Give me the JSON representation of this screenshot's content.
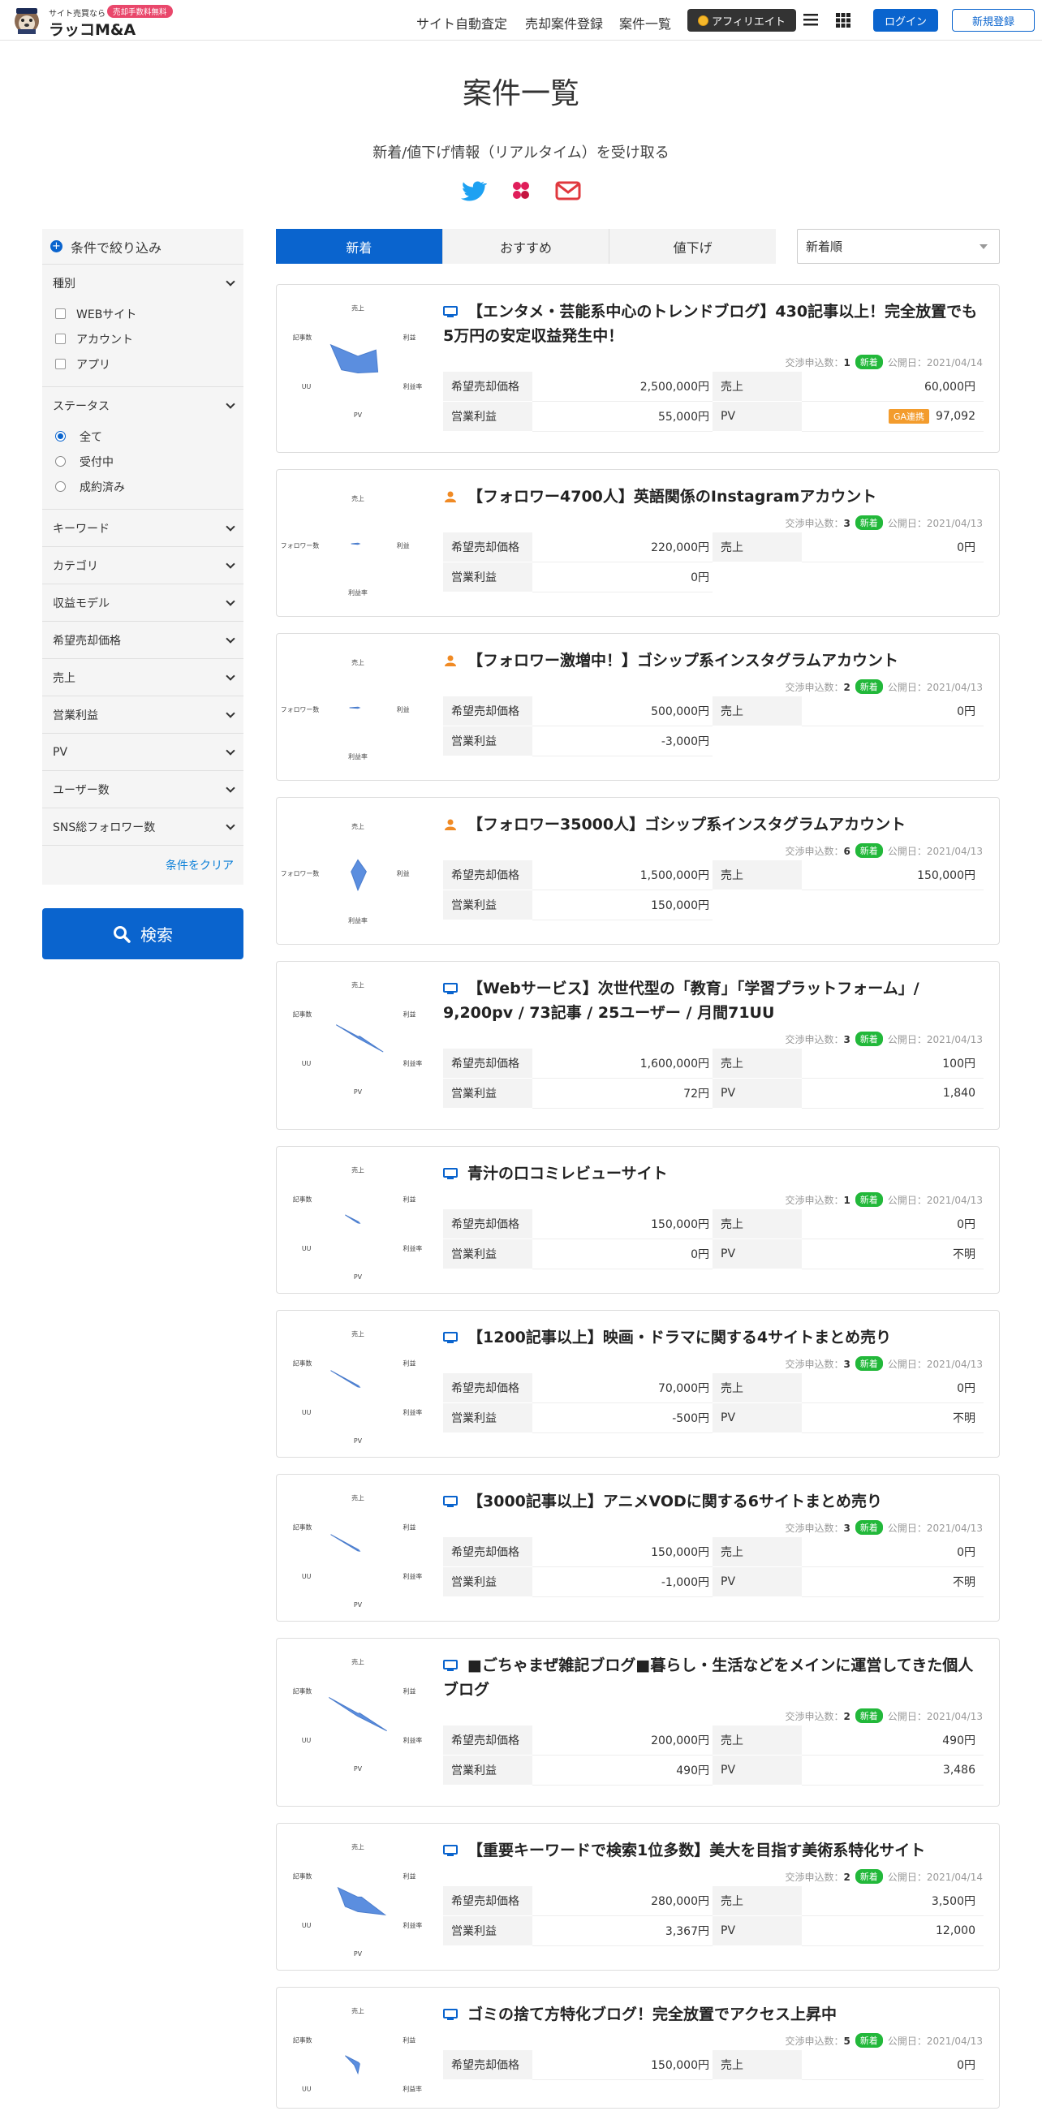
{
  "header": {
    "logo_small": "サイト売買なら",
    "logo_badge": "売却手数料無料",
    "logo_name": "ラッコM&A",
    "nav": [
      "サイト自動査定",
      "売却案件登録",
      "案件一覧"
    ],
    "affiliate": "アフィリエイト",
    "login": "ログイン",
    "register": "新規登録"
  },
  "page": {
    "title": "案件一覧",
    "subscribe": "新着/値下げ情報（リアルタイム）を受け取る"
  },
  "sidebar": {
    "heading": "条件で絞り込み",
    "type_title": "種別",
    "type_options": [
      "WEBサイト",
      "アカウント",
      "アプリ"
    ],
    "status_title": "ステータス",
    "status_options": [
      "全て",
      "受付中",
      "成約済み"
    ],
    "filters": [
      "キーワード",
      "カテゴリ",
      "収益モデル",
      "希望売却価格",
      "売上",
      "営業利益",
      "PV",
      "ユーザー数",
      "SNS総フォロワー数"
    ],
    "clear": "条件をクリア",
    "search": "検索"
  },
  "tabs": [
    "新着",
    "おすすめ",
    "値下げ"
  ],
  "sort": "新着順",
  "labels": {
    "price": "希望売却価格",
    "sales": "売上",
    "profit": "営業利益",
    "pv": "PV",
    "nego": "交渉申込数：",
    "new": "新着",
    "published": "公開日：",
    "ga": "GA連携",
    "radar_web": [
      "売上",
      "利益",
      "利益率",
      "PV",
      "UU",
      "記事数"
    ],
    "radar_sns": [
      "売上",
      "利益",
      "利益率",
      "フォロワー数"
    ]
  },
  "listings": [
    {
      "kind": "web",
      "title": "【エンタメ・芸能系中心のトレンドブログ】430記事以上！完全放置でも5万円の安定収益発生中！",
      "nego": "1",
      "date": "2021/04/14",
      "price": "2,500,000円",
      "sales": "60,000円",
      "profit": "55,000円",
      "pv": "97,092",
      "ga": true,
      "radar": [
        0.1,
        0.5,
        0.55,
        0.3,
        0.45,
        0.75
      ]
    },
    {
      "kind": "sns",
      "title": "【フォロワー4700人】英語関係のInstagramアカウント",
      "nego": "3",
      "date": "2021/04/13",
      "price": "220,000円",
      "sales": "0円",
      "profit": "0円",
      "radar": [
        0.02,
        0.05,
        0.02,
        0.2
      ]
    },
    {
      "kind": "sns",
      "title": "【フォロワー激増中！】ゴシップ系インスタグラムアカウント",
      "nego": "2",
      "date": "2021/04/13",
      "price": "500,000円",
      "sales": "0円",
      "profit": "-3,000円",
      "radar": [
        0.02,
        0.05,
        0.02,
        0.25
      ]
    },
    {
      "kind": "sns",
      "title": "【フォロワー35000人】ゴシップ系インスタグラムアカウント",
      "nego": "6",
      "date": "2021/04/13",
      "price": "1,500,000円",
      "sales": "150,000円",
      "profit": "150,000円",
      "radar": [
        0.35,
        0.25,
        0.55,
        0.2
      ]
    },
    {
      "kind": "web",
      "title": "【Webサービス】次世代型の「教育」「学習プラットフォーム」/ 9,200pv / 73記事 / 25ユーザー / 月間71UU",
      "nego": "3",
      "date": "2021/04/13",
      "price": "1,600,000円",
      "sales": "100円",
      "profit": "72円",
      "pv": "1,840",
      "radar": [
        0.02,
        0.05,
        0.7,
        0.02,
        0.02,
        0.6
      ]
    },
    {
      "kind": "web",
      "title": "青汁の口コミレビューサイト",
      "nego": "1",
      "date": "2021/04/13",
      "price": "150,000円",
      "sales": "0円",
      "profit": "0円",
      "pv": "不明",
      "radar": [
        0.02,
        0.02,
        0.05,
        0.02,
        0.02,
        0.35
      ]
    },
    {
      "kind": "web",
      "title": "【1200記事以上】映画・ドラマに関する4サイトまとめ売り",
      "nego": "3",
      "date": "2021/04/13",
      "price": "70,000円",
      "sales": "0円",
      "profit": "-500円",
      "pv": "不明",
      "radar": [
        0.02,
        0.02,
        0.05,
        0.02,
        0.02,
        0.75
      ]
    },
    {
      "kind": "web",
      "title": "【3000記事以上】アニメVODに関する6サイトまとめ売り",
      "nego": "3",
      "date": "2021/04/13",
      "price": "150,000円",
      "sales": "0円",
      "profit": "-1,000円",
      "pv": "不明",
      "radar": [
        0.02,
        0.02,
        0.05,
        0.02,
        0.02,
        0.75
      ]
    },
    {
      "kind": "web",
      "title": "■ごちゃまぜ雑記ブログ■暮らし・生活などをメインに運営してきた個人ブログ",
      "nego": "2",
      "date": "2021/04/13",
      "price": "200,000円",
      "sales": "490円",
      "profit": "490円",
      "pv": "3,486",
      "radar": [
        0.02,
        0.05,
        0.8,
        0.05,
        0.05,
        0.8
      ]
    },
    {
      "kind": "web",
      "title": "【重要キーワードで検索1位多数】美大を目指す美術系特化サイト",
      "nego": "2",
      "date": "2021/04/14",
      "price": "280,000円",
      "sales": "3,500円",
      "profit": "3,367円",
      "pv": "12,000",
      "radar": [
        0.05,
        0.1,
        0.75,
        0.3,
        0.35,
        0.55
      ]
    },
    {
      "kind": "web",
      "title": "ゴミの捨て方特化ブログ！完全放置でアクセス上昇中",
      "nego": "5",
      "date": "2021/04/13",
      "price": "150,000円",
      "sales": "0円",
      "profit": "",
      "pv": "",
      "radar": [
        0.02,
        0.02,
        0.05,
        0.25,
        0.1,
        0.35
      ]
    }
  ],
  "colors": {
    "accent": "#0a64ce",
    "new": "#22b83a",
    "radar_fill": "#5b8edf"
  }
}
